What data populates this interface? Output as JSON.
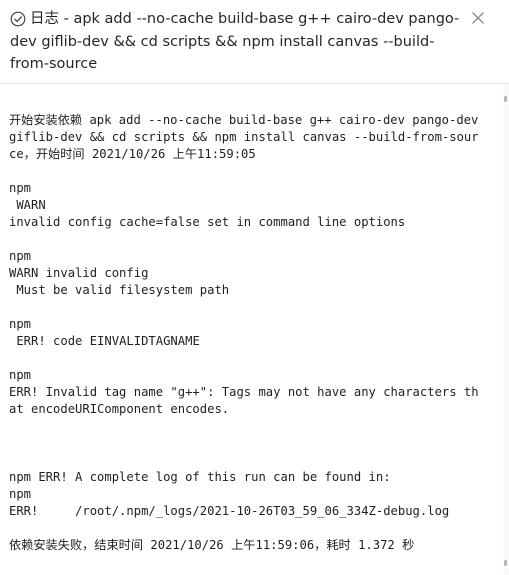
{
  "dialog": {
    "title": "日志 - apk add --no-cache build-base g++ cairo-dev pango-dev giflib-dev && cd scripts && npm install canvas --build-from-source",
    "status_icon": "check-circle-icon",
    "close_icon": "close-icon"
  },
  "log": {
    "lines": [
      "开始安装依赖 apk add --no-cache build-base g++ cairo-dev pango-dev giflib-dev && cd scripts && npm install canvas --build-from-source，开始时间 2021/10/26 上午11:59:05",
      "",
      "npm",
      " WARN",
      "invalid config cache=false set in command line options",
      "",
      "npm",
      "WARN invalid config",
      " Must be valid filesystem path",
      "",
      "npm",
      " ERR! code EINVALIDTAGNAME",
      "",
      "npm",
      "ERR! Invalid tag name \"g++\": Tags may not have any characters that encodeURIComponent encodes.",
      "",
      "",
      "",
      "npm ERR! A complete log of this run can be found in:",
      "npm",
      "ERR!     /root/.npm/_logs/2021-10-26T03_59_06_334Z-debug.log",
      "",
      "依赖安装失败，结束时间 2021/10/26 上午11:59:06，耗时 1.372 秒"
    ]
  }
}
